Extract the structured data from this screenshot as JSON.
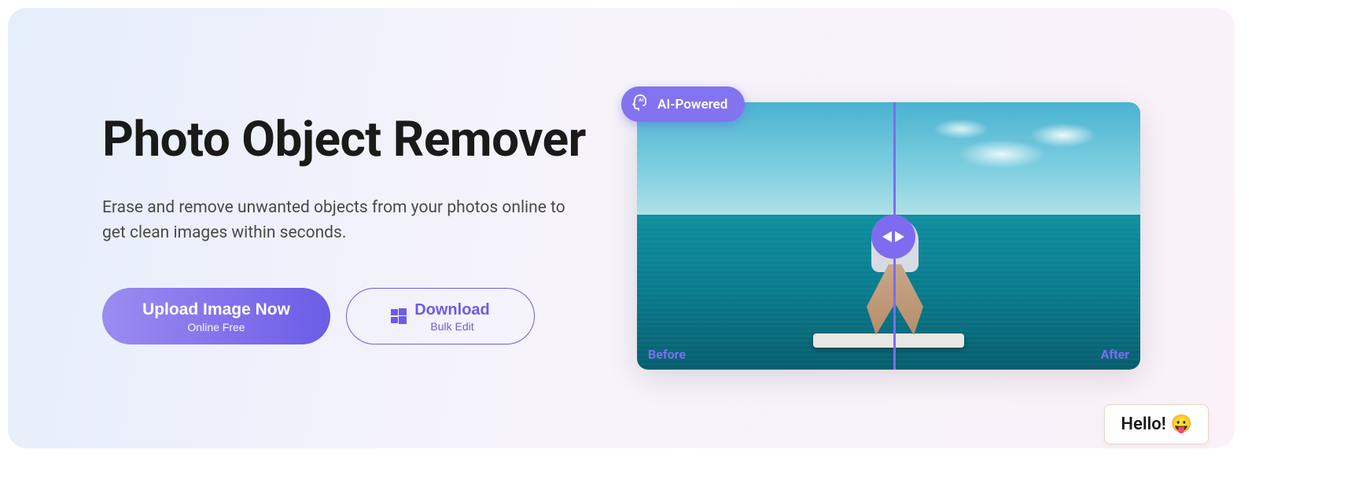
{
  "hero": {
    "title": "Photo Object Remover",
    "subtitle": "Erase and remove unwanted objects from your photos online to get clean images within seconds."
  },
  "buttons": {
    "upload": {
      "title": "Upload Image Now",
      "sub": "Online Free"
    },
    "download": {
      "title": "Download",
      "sub": "Bulk Edit"
    }
  },
  "compare": {
    "badge": "AI-Powered",
    "before_label": "Before",
    "after_label": "After"
  },
  "chat": {
    "greeting": "Hello!"
  }
}
